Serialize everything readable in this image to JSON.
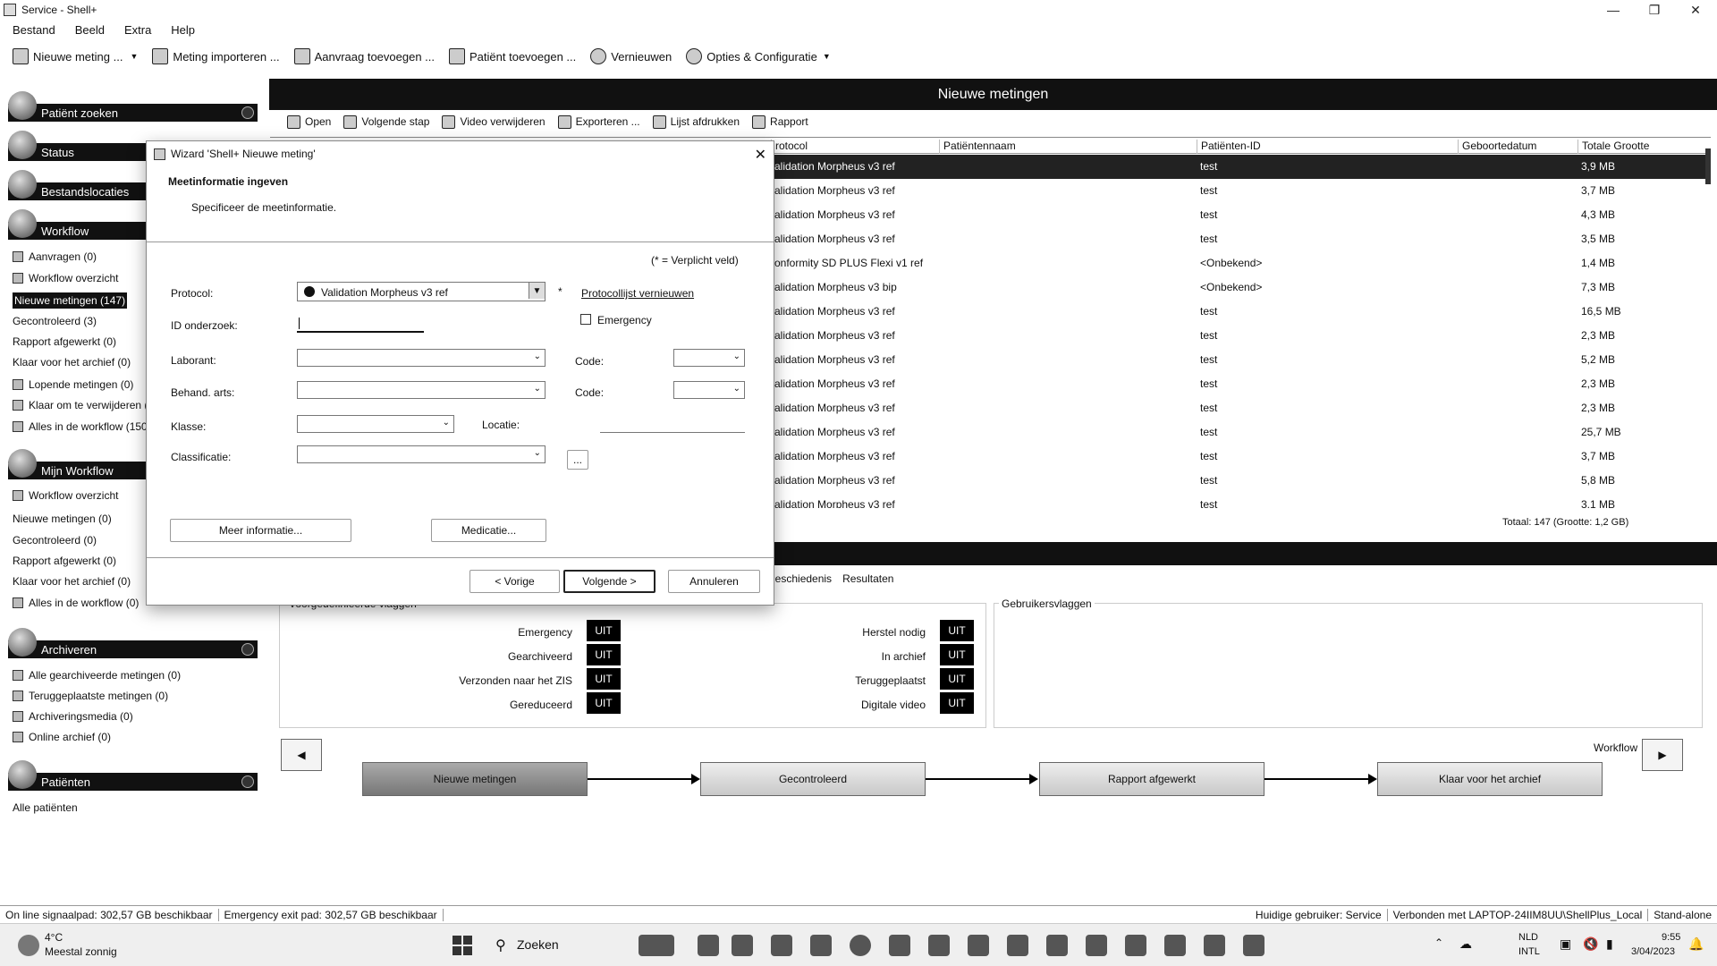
{
  "window": {
    "title": "Service - Shell+"
  },
  "menu": [
    "Bestand",
    "Beeld",
    "Extra",
    "Help"
  ],
  "toolbar": [
    {
      "label": "Nieuwe meting ...",
      "icon": "new-measurement-icon"
    },
    {
      "label": "Meting importeren ...",
      "icon": "import-icon"
    },
    {
      "label": "Aanvraag toevoegen ...",
      "icon": "request-add-icon"
    },
    {
      "label": "Patiënt toevoegen ...",
      "icon": "patient-add-icon"
    },
    {
      "label": "Vernieuwen",
      "icon": "refresh-icon"
    },
    {
      "label": "Opties & Configuratie",
      "icon": "gear-icon"
    }
  ],
  "sidebar": {
    "patient_search": "Patiënt zoeken",
    "status": "Status",
    "locations": "Bestandslocaties",
    "workflow": "Workflow",
    "workflow_items": [
      "Aanvragen (0)",
      "Workflow overzicht",
      "Nieuwe metingen (147)",
      "Gecontroleerd (3)",
      "Rapport afgewerkt (0)",
      "Klaar voor het archief (0)",
      "Lopende metingen (0)",
      "Klaar om te verwijderen (",
      "Alles in de workflow (150"
    ],
    "my_workflow": "Mijn Workflow",
    "my_workflow_items": [
      "Workflow overzicht",
      "Nieuwe metingen (0)",
      "Gecontroleerd (0)",
      "Rapport afgewerkt (0)",
      "Klaar voor het archief (0)",
      "Alles in de workflow (0)"
    ],
    "archive": "Archiveren",
    "archive_items": [
      "Alle gearchiveerde metingen (0)",
      "Teruggeplaatste metingen (0)",
      "Archiveringsmedia (0)",
      "Online archief (0)"
    ],
    "patients": "Patiënten",
    "patients_items": [
      "Alle patiënten"
    ]
  },
  "main": {
    "header": "Nieuwe metingen",
    "actions": [
      "Open",
      "Volgende stap",
      "Video verwijderen",
      "Exporteren ...",
      "Lijst afdrukken",
      "Rapport"
    ],
    "columns": [
      "rotocol",
      "Patiëntennaam",
      "Patiënten-ID",
      "Geboortedatum",
      "Totale Grootte"
    ],
    "rows": [
      [
        "alidation Morpheus v3 ref",
        "test",
        "3,9 MB"
      ],
      [
        "alidation Morpheus v3 ref",
        "test",
        "3,7 MB"
      ],
      [
        "alidation Morpheus v3 ref",
        "test",
        "4,3 MB"
      ],
      [
        "alidation Morpheus v3 ref",
        "test",
        "3,5 MB"
      ],
      [
        "onformity SD PLUS Flexi v1 ref",
        "<Onbekend>",
        "1,4 MB"
      ],
      [
        "alidation Morpheus v3 bip",
        "<Onbekend>",
        "7,3 MB"
      ],
      [
        "alidation Morpheus v3 ref",
        "test",
        "16,5 MB"
      ],
      [
        "alidation Morpheus v3 ref",
        "test",
        "2,3 MB"
      ],
      [
        "alidation Morpheus v3 ref",
        "test",
        "5,2 MB"
      ],
      [
        "alidation Morpheus v3 ref",
        "test",
        "2,3 MB"
      ],
      [
        "alidation Morpheus v3 ref",
        "test",
        "2,3 MB"
      ],
      [
        "alidation Morpheus v3 ref",
        "test",
        "25,7 MB"
      ],
      [
        "alidation Morpheus v3 ref",
        "test",
        "3,7 MB"
      ],
      [
        "alidation Morpheus v3 ref",
        "test",
        "5,8 MB"
      ],
      [
        "alidation Morpheus v3 ref",
        "test",
        "3,1 MB"
      ]
    ],
    "totals": "Totaal: 147 (Grootte: 1,2 GB)"
  },
  "bottom": {
    "tabs": [
      "geschiedenis",
      "Resultaten"
    ],
    "system_flags_title": "Voorgedefinieerde vlaggen",
    "user_flags_title": "Gebruikersvlaggen",
    "flags_left": [
      [
        "Emergency",
        "UIT"
      ],
      [
        "Gearchiveerd",
        "UIT"
      ],
      [
        "Verzonden naar het ZIS",
        "UIT"
      ],
      [
        "Gereduceerd",
        "UIT"
      ]
    ],
    "flags_right": [
      [
        "Herstel nodig",
        "UIT"
      ],
      [
        "In archief",
        "UIT"
      ],
      [
        "Teruggeplaatst",
        "UIT"
      ],
      [
        "Digitale video",
        "UIT"
      ]
    ],
    "workflow_label": "Workflow",
    "stages": [
      "Nieuwe metingen",
      "Gecontroleerd",
      "Rapport afgewerkt",
      "Klaar voor het archief"
    ]
  },
  "status": [
    "On line signaalpad: 302,57 GB beschikbaar",
    "Emergency exit pad: 302,57 GB beschikbaar",
    "Huidige gebruiker: Service",
    "Verbonden met LAPTOP-24IIM8UU\\ShellPlus_Local",
    "Stand-alone"
  ],
  "taskbar": {
    "temp": "4°C",
    "weather": "Meestal zonnig",
    "search": "Zoeken",
    "lang1": "NLD",
    "lang2": "INTL",
    "time": "9:55",
    "date": "3/04/2023"
  },
  "dialog": {
    "title": "Wizard 'Shell+ Nieuwe meting'",
    "heading": "Meetinformatie ingeven",
    "subheading": "Specificeer de meetinformatie.",
    "required_note": "(* = Verplicht veld)",
    "protocol_label": "Protocol:",
    "protocol_value": "Validation Morpheus v3 ref",
    "star": "*",
    "refresh_link": "Protocollijst vernieuwen",
    "id_label": "ID onderzoek:",
    "emergency_label": "Emergency",
    "laborant_label": "Laborant:",
    "code_label": "Code:",
    "doctor_label": "Behand. arts:",
    "class_label": "Klasse:",
    "location_label": "Locatie:",
    "classification_label": "Classificatie:",
    "ellipsis": "...",
    "more_info": "Meer informatie...",
    "medication": "Medicatie...",
    "prev": "< Vorige",
    "next": "Volgende >",
    "cancel": "Annuleren"
  }
}
